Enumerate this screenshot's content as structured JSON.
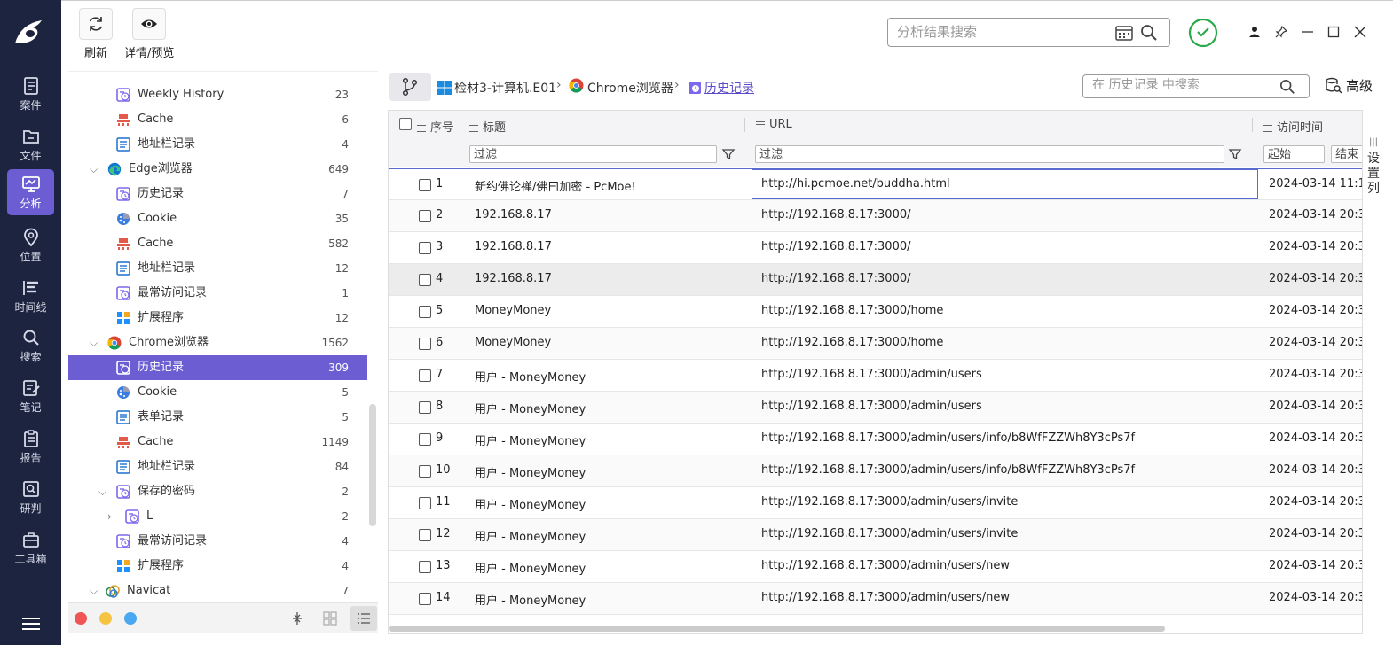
{
  "nav": {
    "items": [
      {
        "label": "案件",
        "icon": "case-icon"
      },
      {
        "label": "文件",
        "icon": "folder-icon"
      },
      {
        "label": "分析",
        "icon": "analysis-icon",
        "active": true
      },
      {
        "label": "位置",
        "icon": "location-icon"
      },
      {
        "label": "时间线",
        "icon": "timeline-icon"
      },
      {
        "label": "搜索",
        "icon": "search-icon"
      },
      {
        "label": "笔记",
        "icon": "note-icon"
      },
      {
        "label": "报告",
        "icon": "report-icon"
      },
      {
        "label": "研判",
        "icon": "judge-icon"
      },
      {
        "label": "工具箱",
        "icon": "toolbox-icon"
      }
    ]
  },
  "toolbar": {
    "refresh_label": "刷新",
    "preview_label": "详情/预览",
    "search_placeholder": "分析结果搜索"
  },
  "tree": {
    "rows": [
      {
        "label": "Weekly History",
        "count": "23",
        "icon": "history-icon"
      },
      {
        "label": "Cache",
        "count": "6",
        "icon": "cache-icon"
      },
      {
        "label": "地址栏记录",
        "count": "4",
        "icon": "list-icon"
      },
      {
        "label": "Edge浏览器",
        "count": "649",
        "icon": "edge-icon"
      },
      {
        "label": "历史记录",
        "count": "7",
        "icon": "history-icon"
      },
      {
        "label": "Cookie",
        "count": "35",
        "icon": "cookie-icon"
      },
      {
        "label": "Cache",
        "count": "582",
        "icon": "cache-icon"
      },
      {
        "label": "地址栏记录",
        "count": "12",
        "icon": "list-icon"
      },
      {
        "label": "最常访问记录",
        "count": "1",
        "icon": "history-icon"
      },
      {
        "label": "扩展程序",
        "count": "12",
        "icon": "extension-icon"
      },
      {
        "label": "Chrome浏览器",
        "count": "1562",
        "icon": "chrome-icon"
      },
      {
        "label": "历史记录",
        "count": "309",
        "icon": "history-icon"
      },
      {
        "label": "Cookie",
        "count": "5",
        "icon": "cookie-icon"
      },
      {
        "label": "表单记录",
        "count": "5",
        "icon": "list-icon"
      },
      {
        "label": "Cache",
        "count": "1149",
        "icon": "cache-icon"
      },
      {
        "label": "地址栏记录",
        "count": "84",
        "icon": "list-icon"
      },
      {
        "label": "保存的密码",
        "count": "2",
        "icon": "history-icon"
      },
      {
        "label": "L",
        "count": "2",
        "icon": "history-icon"
      },
      {
        "label": "最常访问记录",
        "count": "4",
        "icon": "history-icon"
      },
      {
        "label": "扩展程序",
        "count": "4",
        "icon": "extension-icon"
      },
      {
        "label": "Navicat",
        "count": "7",
        "icon": "navicat-icon"
      }
    ]
  },
  "breadcrumb": {
    "items": [
      "检材3-计算机.E01",
      "Chrome浏览器",
      "历史记录"
    ],
    "search_placeholder": "在 历史记录 中搜索",
    "advanced_label": "高级"
  },
  "table": {
    "headers": {
      "seq": "序号",
      "title": "标题",
      "url": "URL",
      "time": "访问时间"
    },
    "filters": {
      "title": "过滤",
      "url": "过滤",
      "start": "起始",
      "end": "结束"
    },
    "rows": [
      {
        "seq": "1",
        "title": "新约佛论禅/佛曰加密 - PcMoe!",
        "url": "http://hi.pcmoe.net/buddha.html",
        "time": "2024-03-14 11:1"
      },
      {
        "seq": "2",
        "title": "192.168.8.17",
        "url": "http://192.168.8.17:3000/",
        "time": "2024-03-14 20:3"
      },
      {
        "seq": "3",
        "title": "192.168.8.17",
        "url": "http://192.168.8.17:3000/",
        "time": "2024-03-14 20:3"
      },
      {
        "seq": "4",
        "title": "192.168.8.17",
        "url": "http://192.168.8.17:3000/",
        "time": "2024-03-14 20:3"
      },
      {
        "seq": "5",
        "title": "MoneyMoney",
        "url": "http://192.168.8.17:3000/home",
        "time": "2024-03-14 20:3"
      },
      {
        "seq": "6",
        "title": "MoneyMoney",
        "url": "http://192.168.8.17:3000/home",
        "time": "2024-03-14 20:3"
      },
      {
        "seq": "7",
        "title": "用户 - MoneyMoney",
        "url": "http://192.168.8.17:3000/admin/users",
        "time": "2024-03-14 20:3"
      },
      {
        "seq": "8",
        "title": "用户 - MoneyMoney",
        "url": "http://192.168.8.17:3000/admin/users",
        "time": "2024-03-14 20:3"
      },
      {
        "seq": "9",
        "title": "用户 - MoneyMoney",
        "url": "http://192.168.8.17:3000/admin/users/info/b8WfFZZWh8Y3cPs7f",
        "time": "2024-03-14 20:3"
      },
      {
        "seq": "10",
        "title": "用户 - MoneyMoney",
        "url": "http://192.168.8.17:3000/admin/users/info/b8WfFZZWh8Y3cPs7f",
        "time": "2024-03-14 20:3"
      },
      {
        "seq": "11",
        "title": "用户 - MoneyMoney",
        "url": "http://192.168.8.17:3000/admin/users/invite",
        "time": "2024-03-14 20:3"
      },
      {
        "seq": "12",
        "title": "用户 - MoneyMoney",
        "url": "http://192.168.8.17:3000/admin/users/invite",
        "time": "2024-03-14 20:3"
      },
      {
        "seq": "13",
        "title": "用户 - MoneyMoney",
        "url": "http://192.168.8.17:3000/admin/users/new",
        "time": "2024-03-14 20:3"
      },
      {
        "seq": "14",
        "title": "用户 - MoneyMoney",
        "url": "http://192.168.8.17:3000/admin/users/new",
        "time": "2024-03-14 20:3"
      }
    ],
    "column_settings_label": "设置列"
  },
  "colors": {
    "nav_bg": "#1d2440",
    "accent": "#6c5dd3",
    "status_green": "#2aa94a",
    "dot_red": "#f05454",
    "dot_yellow": "#f5c443",
    "dot_blue": "#4aa8f0"
  }
}
